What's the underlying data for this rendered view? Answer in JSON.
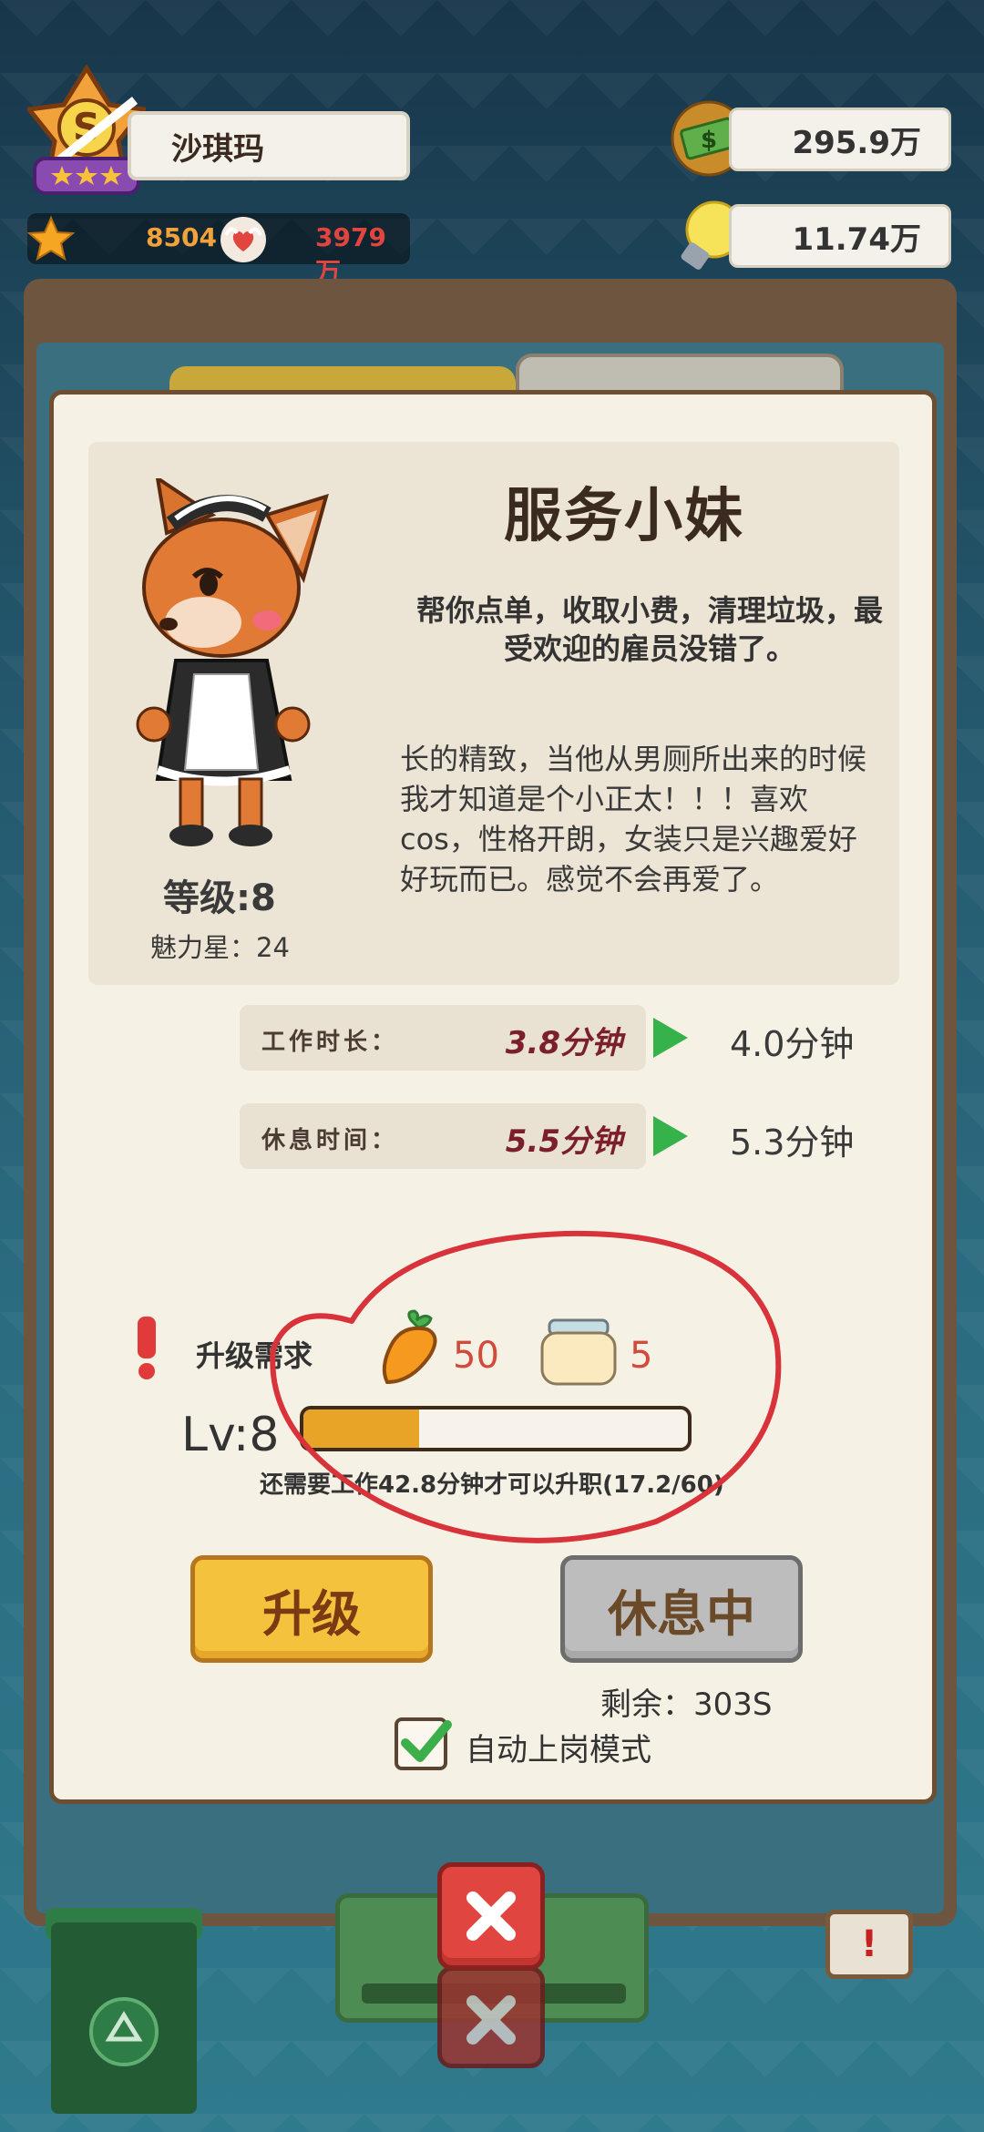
{
  "hud": {
    "player_name": "沙琪玛",
    "stars": "8504",
    "hearts": "3979万",
    "money": "295.9万",
    "bulbs": "11.74万"
  },
  "employee": {
    "title": "服务小妹",
    "short_desc": "帮你点单，收取小费，清理垃圾，最受欢迎的雇员没错了。",
    "long_desc": "长的精致，当他从男厕所出来的时候我才知道是个小正太！！！喜欢cos，性格开朗，女装只是兴趣爱好好玩而已。感觉不会再爱了。",
    "level_label": "等级:8",
    "charm_label": "魅力星：24"
  },
  "stats": {
    "work_label": "工作时长：",
    "work_old": "3.8分钟",
    "work_new": "4.0分钟",
    "rest_label": "休息时间：",
    "rest_old": "5.5分钟",
    "rest_new": "5.3分钟"
  },
  "upgrade": {
    "req_label": "升级需求",
    "carrot_count": "50",
    "jar_count": "5",
    "lv_text": "Lv:8",
    "progress": 0.3,
    "progress_note": "还需要工作42.8分钟才可以升职(17.2/60)"
  },
  "buttons": {
    "upgrade": "升级",
    "resting": "休息中",
    "remain": "剩余：303S",
    "auto_mode": "自动上岗模式"
  },
  "bottom": {
    "warn": "!"
  },
  "colors": {
    "accent": "#f5c23d",
    "close": "#e0453f",
    "play": "#35b24a"
  }
}
